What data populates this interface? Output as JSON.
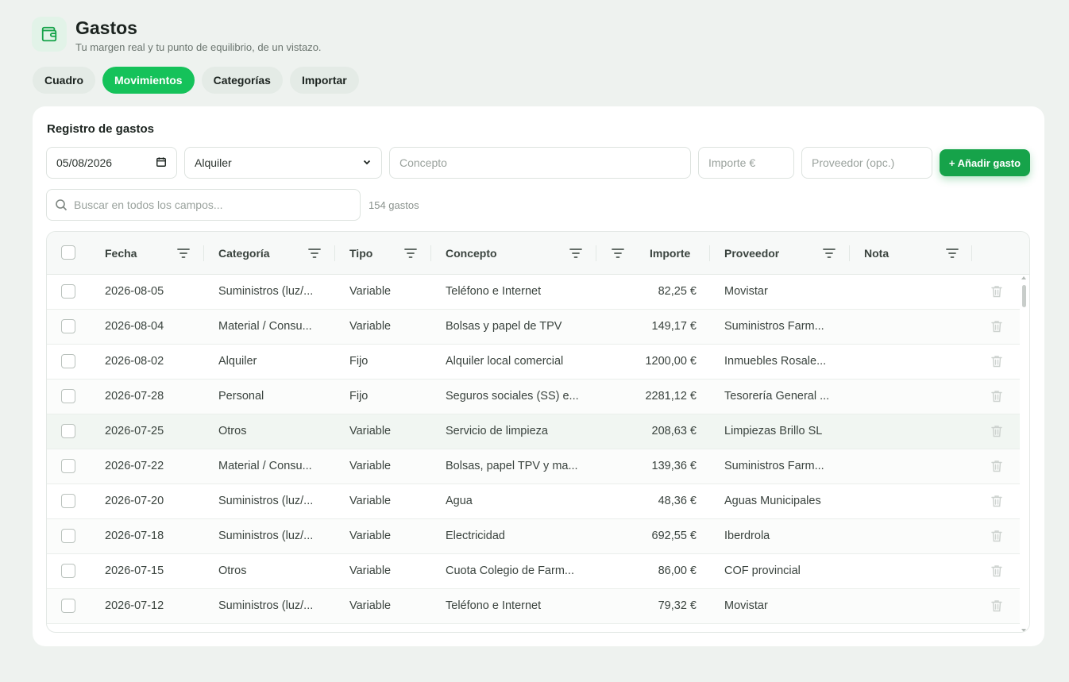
{
  "header": {
    "title": "Gastos",
    "subtitle": "Tu margen real y tu punto de equilibrio, de un vistazo.",
    "icon": "wallet-icon"
  },
  "tabs": [
    {
      "label": "Cuadro",
      "active": false
    },
    {
      "label": "Movimientos",
      "active": true
    },
    {
      "label": "Categorías",
      "active": false
    },
    {
      "label": "Importar",
      "active": false
    }
  ],
  "form": {
    "section_title": "Registro de gastos",
    "date_value": "05/08/2026",
    "category_value": "Alquiler",
    "concept_placeholder": "Concepto",
    "amount_placeholder": "Importe €",
    "supplier_placeholder": "Proveedor (opc.)",
    "add_label": "+ Añadir gasto"
  },
  "search": {
    "placeholder": "Buscar en todos los campos...",
    "count": "154 gastos"
  },
  "columns": [
    "Fecha",
    "Categoría",
    "Tipo",
    "Concepto",
    "Importe",
    "Proveedor",
    "Nota"
  ],
  "rows": [
    {
      "fecha": "2026-08-05",
      "categoria": "Suministros (luz/...",
      "tipo": "Variable",
      "concepto": "Teléfono e Internet",
      "importe": "82,25 €",
      "proveedor": "Movistar",
      "nota": ""
    },
    {
      "fecha": "2026-08-04",
      "categoria": "Material / Consu...",
      "tipo": "Variable",
      "concepto": "Bolsas y papel de TPV",
      "importe": "149,17 €",
      "proveedor": "Suministros Farm...",
      "nota": ""
    },
    {
      "fecha": "2026-08-02",
      "categoria": "Alquiler",
      "tipo": "Fijo",
      "concepto": "Alquiler local comercial",
      "importe": "1200,00 €",
      "proveedor": "Inmuebles Rosale...",
      "nota": ""
    },
    {
      "fecha": "2026-07-28",
      "categoria": "Personal",
      "tipo": "Fijo",
      "concepto": "Seguros sociales (SS) e...",
      "importe": "2281,12 €",
      "proveedor": "Tesorería General ...",
      "nota": ""
    },
    {
      "fecha": "2026-07-25",
      "categoria": "Otros",
      "tipo": "Variable",
      "concepto": "Servicio de limpieza",
      "importe": "208,63 €",
      "proveedor": "Limpiezas Brillo SL",
      "nota": ""
    },
    {
      "fecha": "2026-07-22",
      "categoria": "Material / Consu...",
      "tipo": "Variable",
      "concepto": "Bolsas, papel TPV y ma...",
      "importe": "139,36 €",
      "proveedor": "Suministros Farm...",
      "nota": ""
    },
    {
      "fecha": "2026-07-20",
      "categoria": "Suministros (luz/...",
      "tipo": "Variable",
      "concepto": "Agua",
      "importe": "48,36 €",
      "proveedor": "Aguas Municipales",
      "nota": ""
    },
    {
      "fecha": "2026-07-18",
      "categoria": "Suministros (luz/...",
      "tipo": "Variable",
      "concepto": "Electricidad",
      "importe": "692,55 €",
      "proveedor": "Iberdrola",
      "nota": ""
    },
    {
      "fecha": "2026-07-15",
      "categoria": "Otros",
      "tipo": "Variable",
      "concepto": "Cuota Colegio de Farm...",
      "importe": "86,00 €",
      "proveedor": "COF provincial",
      "nota": ""
    },
    {
      "fecha": "2026-07-12",
      "categoria": "Suministros (luz/...",
      "tipo": "Variable",
      "concepto": "Teléfono e Internet",
      "importe": "79,32 €",
      "proveedor": "Movistar",
      "nota": ""
    }
  ],
  "colors": {
    "accent": "#15c25a",
    "button": "#16a34a",
    "background": "#eef2ef"
  }
}
